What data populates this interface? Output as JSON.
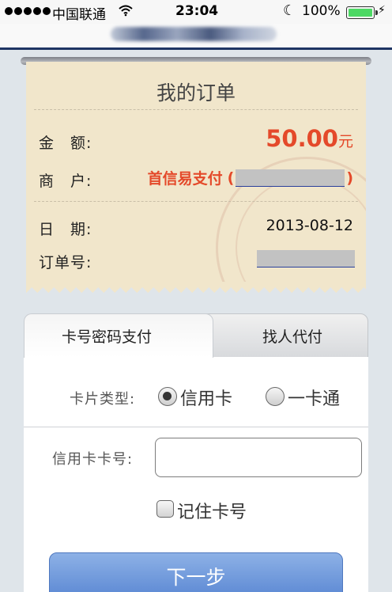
{
  "status_bar": {
    "carrier": "中国联通",
    "time": "23:04",
    "battery_percent": "100%",
    "battery_level": 1.0,
    "battery_color": "#4cd964"
  },
  "order": {
    "title": "我的订单",
    "amount_label": "金　额:",
    "amount_value": "50.00",
    "amount_unit": "元",
    "merchant_label": "商　户:",
    "merchant_name": "首信易支付",
    "merchant_paren_open": "(",
    "merchant_paren_close": ")",
    "date_label": "日　期:",
    "date_value": "2013-08-12",
    "order_no_label": "订单号:",
    "accent_color": "#e4492a"
  },
  "tabs": [
    {
      "label": "卡号密码支付",
      "active": true
    },
    {
      "label": "找人代付",
      "active": false
    }
  ],
  "form": {
    "card_type_label": "卡片类型:",
    "card_type_options": [
      {
        "label": "信用卡",
        "selected": true
      },
      {
        "label": "一卡通",
        "selected": false
      }
    ],
    "card_number_label": "信用卡卡号:",
    "card_number_value": "",
    "remember_label": "记住卡号",
    "remember_checked": false,
    "next_button_label": "下一步",
    "button_color": "#5a87d3"
  },
  "icons": {
    "wifi": "wifi-icon",
    "moon": "moon-icon",
    "battery": "battery-icon",
    "bolt": "charging-bolt-icon",
    "signal": "signal-dots-icon"
  }
}
